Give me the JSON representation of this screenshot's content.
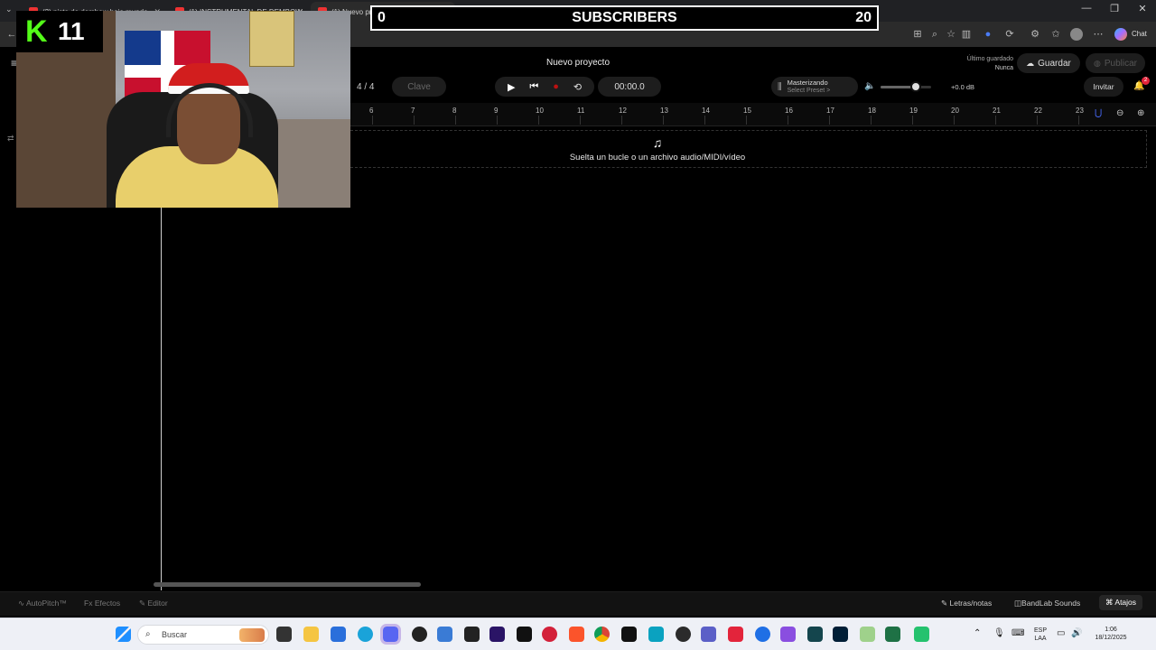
{
  "browser": {
    "tabs": [
      {
        "label": "(2) pista de dembow bajo mundo"
      },
      {
        "label": "(1) INSTRUMENTAL DE DEMBOW"
      },
      {
        "label": "(1) Nuevo proyecto - Studio"
      }
    ],
    "new_tab_glyph": "+",
    "chat_label": "Chat"
  },
  "overlay": {
    "subs_left": "0",
    "subs_center": "SUBSCRIBERS",
    "subs_right": "20",
    "kick_letter": "K",
    "kick_count": "11"
  },
  "studio": {
    "project_title": "Nuevo proyecto",
    "last_saved_label": "Último guardado",
    "last_saved_value": "Nunca",
    "save_label": "Guardar",
    "publish_label": "Publicar",
    "time_signature": "4 / 4",
    "key_label": "Clave",
    "time_display": "00:00.0",
    "mastering_title": "Masterizando",
    "mastering_preset": "Select Preset >",
    "volume_db": "+0.0 dB",
    "volume_level": 0.7,
    "invite_label": "Invitar",
    "notification_count": "2",
    "ruler_marks": [
      "6",
      "7",
      "8",
      "9",
      "10",
      "11",
      "12",
      "13",
      "14",
      "15",
      "16",
      "17",
      "18",
      "19",
      "20",
      "21",
      "22",
      "23"
    ],
    "drop_text": "Suelta un bucle o un archivo audio/MIDI/vídeo"
  },
  "bottom": {
    "autopitch": "AutoPitch™",
    "effects": "Efectos",
    "editor": "Editor",
    "lyrics": "Letras/notas",
    "sounds": "BandLab Sounds",
    "shortcuts": "Atajos"
  },
  "taskbar": {
    "search_placeholder": "Buscar",
    "lang_top": "ESP",
    "lang_bottom": "LAA",
    "time": "1:06",
    "date": "18/12/2025"
  }
}
